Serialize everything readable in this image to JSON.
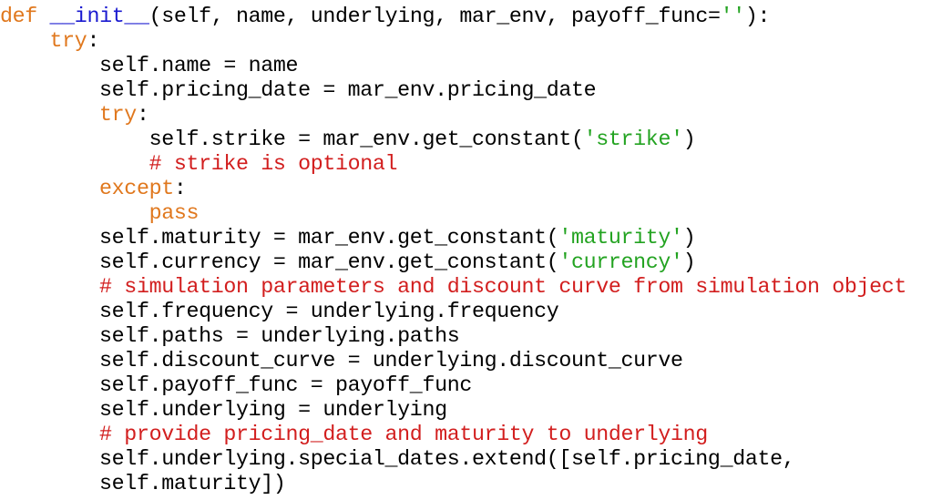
{
  "colors": {
    "keyword": "#e0781e",
    "function_name": "#1a1ad0",
    "string": "#23a321",
    "comment": "#d21e1e",
    "text": "#000000",
    "background": "#ffffff"
  },
  "code_lines": [
    {
      "indent": 0,
      "tokens": [
        {
          "t": "kw",
          "v": "def"
        },
        {
          "t": "tx",
          "v": " "
        },
        {
          "t": "fn",
          "v": "__init__"
        },
        {
          "t": "tx",
          "v": "(self, name, underlying, mar_env, payoff_func="
        },
        {
          "t": "str",
          "v": "''"
        },
        {
          "t": "tx",
          "v": "):"
        }
      ]
    },
    {
      "indent": 4,
      "tokens": [
        {
          "t": "kw",
          "v": "try"
        },
        {
          "t": "tx",
          "v": ":"
        }
      ]
    },
    {
      "indent": 8,
      "tokens": [
        {
          "t": "tx",
          "v": "self.name = name"
        }
      ]
    },
    {
      "indent": 8,
      "tokens": [
        {
          "t": "tx",
          "v": "self.pricing_date = mar_env.pricing_date"
        }
      ]
    },
    {
      "indent": 8,
      "tokens": [
        {
          "t": "kw",
          "v": "try"
        },
        {
          "t": "tx",
          "v": ":"
        }
      ]
    },
    {
      "indent": 12,
      "tokens": [
        {
          "t": "tx",
          "v": "self.strike = mar_env.get_constant("
        },
        {
          "t": "str",
          "v": "'strike'"
        },
        {
          "t": "tx",
          "v": ")"
        }
      ]
    },
    {
      "indent": 12,
      "tokens": [
        {
          "t": "cm",
          "v": "# strike is optional"
        }
      ]
    },
    {
      "indent": 8,
      "tokens": [
        {
          "t": "kw",
          "v": "except"
        },
        {
          "t": "tx",
          "v": ":"
        }
      ]
    },
    {
      "indent": 12,
      "tokens": [
        {
          "t": "kw",
          "v": "pass"
        }
      ]
    },
    {
      "indent": 8,
      "tokens": [
        {
          "t": "tx",
          "v": "self.maturity = mar_env.get_constant("
        },
        {
          "t": "str",
          "v": "'maturity'"
        },
        {
          "t": "tx",
          "v": ")"
        }
      ]
    },
    {
      "indent": 8,
      "tokens": [
        {
          "t": "tx",
          "v": "self.currency = mar_env.get_constant("
        },
        {
          "t": "str",
          "v": "'currency'"
        },
        {
          "t": "tx",
          "v": ")"
        }
      ]
    },
    {
      "indent": 8,
      "tokens": [
        {
          "t": "cm",
          "v": "# simulation parameters and discount curve from simulation object"
        }
      ]
    },
    {
      "indent": 8,
      "tokens": [
        {
          "t": "tx",
          "v": "self.frequency = underlying.frequency"
        }
      ]
    },
    {
      "indent": 8,
      "tokens": [
        {
          "t": "tx",
          "v": "self.paths = underlying.paths"
        }
      ]
    },
    {
      "indent": 8,
      "tokens": [
        {
          "t": "tx",
          "v": "self.discount_curve = underlying.discount_curve"
        }
      ]
    },
    {
      "indent": 8,
      "tokens": [
        {
          "t": "tx",
          "v": "self.payoff_func = payoff_func"
        }
      ]
    },
    {
      "indent": 8,
      "tokens": [
        {
          "t": "tx",
          "v": "self.underlying = underlying"
        }
      ]
    },
    {
      "indent": 8,
      "tokens": [
        {
          "t": "cm",
          "v": "# provide pricing_date and maturity to underlying"
        }
      ]
    },
    {
      "indent": 8,
      "tokens": [
        {
          "t": "tx",
          "v": "self.underlying.special_dates.extend([self.pricing_date,"
        }
      ]
    },
    {
      "indent": 8,
      "tokens": [
        {
          "t": "tx",
          "v": "self.maturity])"
        }
      ]
    }
  ]
}
